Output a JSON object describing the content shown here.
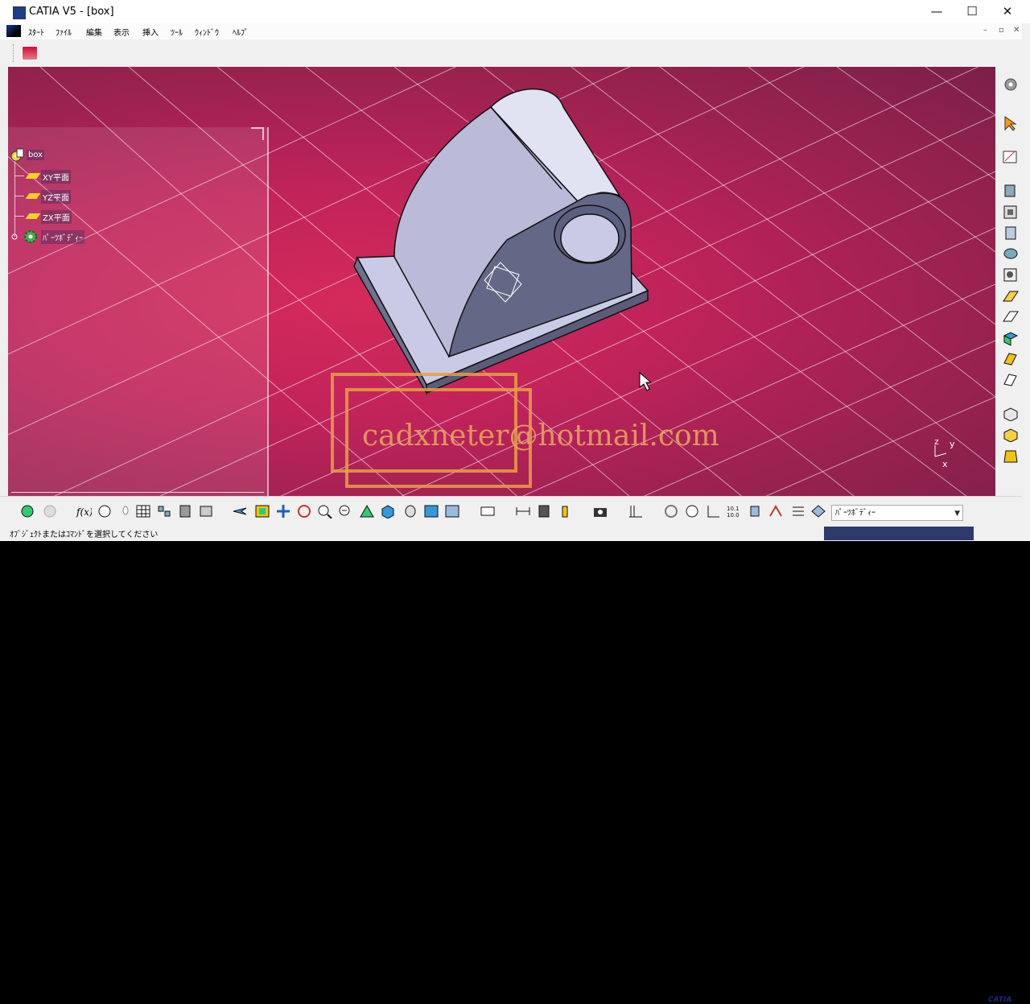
{
  "window": {
    "title": "CATIA V5 - [box]",
    "min": "—",
    "max": "☐",
    "close": "✕"
  },
  "menu": {
    "items": [
      "ｽﾀｰﾄ",
      "ﾌｧｲﾙ",
      "編集",
      "表示",
      "挿入",
      "ﾂｰﾙ",
      "ｳｨﾝﾄﾞｳ",
      "ﾍﾙﾌﾟ"
    ],
    "mdi": [
      "–",
      "▫",
      "✕"
    ]
  },
  "tree": {
    "root": "box",
    "items": [
      "XY平面",
      "YZ平面",
      "ZX平面"
    ],
    "body": "ﾊﾟｰﾂﾎﾞﾃﾞｨｰ"
  },
  "watermark": "cadxneter@hotmail.com",
  "compass": {
    "z": "z",
    "y": "y",
    "x": "x"
  },
  "bottom": {
    "combo_value": "ﾊﾟｰﾂﾎﾞﾃﾞｨｰ",
    "logo": "CATIA"
  },
  "status": {
    "message": "ｵﾌﾞｼﾞｪｸﾄまたはｺﾏﾝﾄﾞを選択してください"
  },
  "colors": {
    "viewport": "#c0235a",
    "part": "#c9cbe6",
    "command_box": "#2d3a6b",
    "watermark": "#e8a060"
  }
}
